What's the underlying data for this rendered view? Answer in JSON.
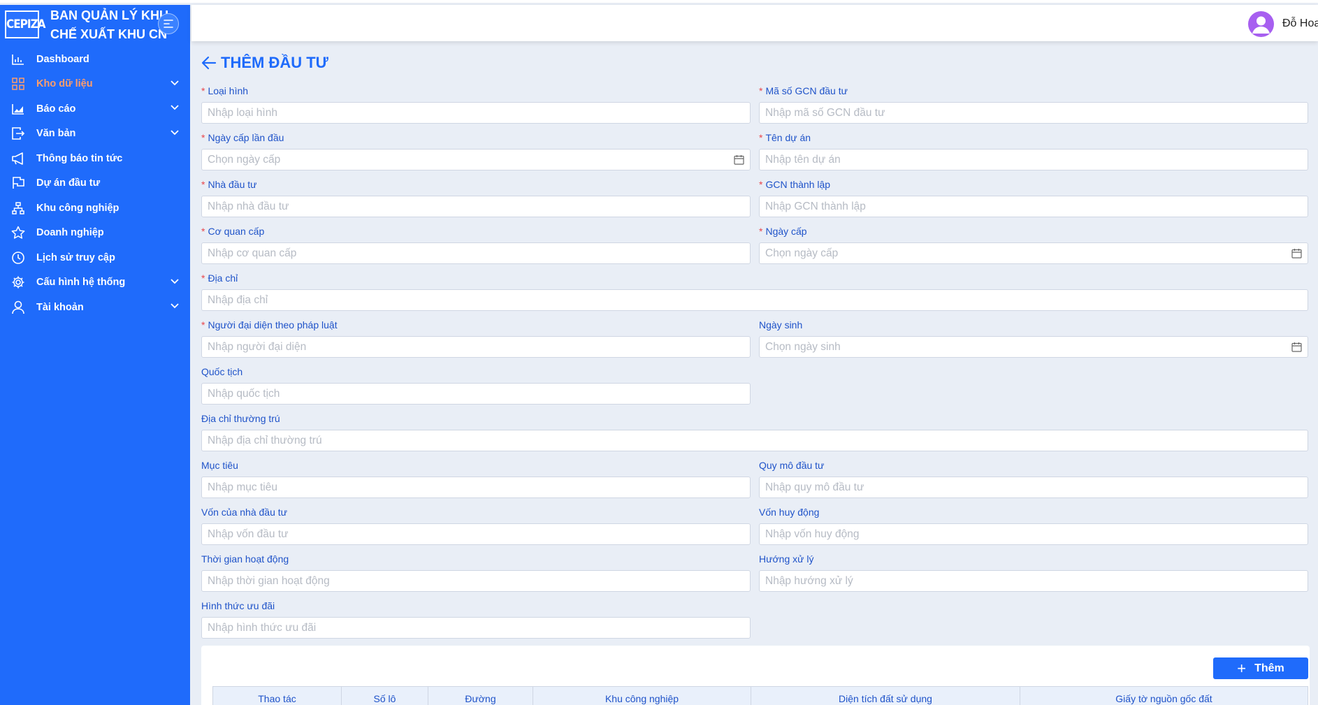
{
  "sidebar": {
    "logo_text": "CEPIZA",
    "brand_title": "BAN QUẢN LÝ KHU\nCHẾ XUẤT KHU CN",
    "items": [
      {
        "label": "Dashboard"
      },
      {
        "label": "Kho dữ liệu"
      },
      {
        "label": "Báo cáo"
      },
      {
        "label": "Văn bản"
      },
      {
        "label": "Thông báo tin tức"
      },
      {
        "label": "Dự án đầu tư"
      },
      {
        "label": "Khu công nghiệp"
      },
      {
        "label": "Doanh nghiệp"
      },
      {
        "label": "Lịch sử truy cập"
      },
      {
        "label": "Cấu hình hệ thống"
      },
      {
        "label": "Tài khoản"
      }
    ]
  },
  "header": {
    "username": "Đỗ Hoa"
  },
  "page": {
    "title": "THÊM ĐẦU TƯ"
  },
  "form": {
    "loai_hinh": {
      "label": "Loại hình",
      "placeholder": "Nhập loại hình"
    },
    "ma_so_gcn": {
      "label": "Mã số GCN đầu tư",
      "placeholder": "Nhập mã số GCN đầu tư"
    },
    "ngay_cap_lan_dau": {
      "label": "Ngày cấp lần đầu",
      "placeholder": "Chọn ngày cấp"
    },
    "ten_du_an": {
      "label": "Tên dự án",
      "placeholder": "Nhập tên dự án"
    },
    "nha_dau_tu": {
      "label": "Nhà đầu tư",
      "placeholder": "Nhập nhà đầu tư"
    },
    "gcn_thanh_lap": {
      "label": "GCN thành lập",
      "placeholder": "Nhập GCN thành lập"
    },
    "co_quan_cap": {
      "label": "Cơ quan cấp",
      "placeholder": "Nhập cơ quan cấp"
    },
    "ngay_cap": {
      "label": "Ngày cấp",
      "placeholder": "Chọn ngày cấp"
    },
    "dia_chi": {
      "label": "Địa chỉ",
      "placeholder": "Nhập địa chỉ"
    },
    "nguoi_dai_dien": {
      "label": "Người đại diện theo pháp luật",
      "placeholder": "Nhập người đại diện"
    },
    "ngay_sinh": {
      "label": "Ngày sinh",
      "placeholder": "Chọn ngày sinh"
    },
    "quoc_tich": {
      "label": "Quốc tịch",
      "placeholder": "Nhập quốc tịch"
    },
    "dia_chi_thuong_tru": {
      "label": "Địa chỉ thường trú",
      "placeholder": "Nhập địa chỉ thường trú"
    },
    "muc_tieu": {
      "label": "Mục tiêu",
      "placeholder": "Nhập mục tiêu"
    },
    "quy_mo": {
      "label": "Quy mô đầu tư",
      "placeholder": "Nhập quy mô đầu tư"
    },
    "von_nha_dau_tu": {
      "label": "Vốn của nhà đầu tư",
      "placeholder": "Nhập vốn đầu tư"
    },
    "von_huy_dong": {
      "label": "Vốn huy động",
      "placeholder": "Nhập vốn huy động"
    },
    "thoi_gian_hoat_dong": {
      "label": "Thời gian hoạt động",
      "placeholder": "Nhập thời gian hoạt động"
    },
    "huong_xu_ly": {
      "label": "Hướng xử lý",
      "placeholder": "Nhập hướng xử lý"
    },
    "hinh_thuc_uu_dai": {
      "label": "Hình thức ưu đãi",
      "placeholder": "Nhập hình thức ưu đãi"
    }
  },
  "table": {
    "add_label": "Thêm",
    "columns": [
      "Thao tác",
      "Số lô",
      "Đường",
      "Khu công nghiệp",
      "Diện tích đất sử dụng",
      "Giấy tờ nguồn gốc đất"
    ]
  },
  "colors": {
    "primary": "#1f6bfb",
    "active_menu": "#ff9d6b",
    "required": "#e8464c"
  }
}
